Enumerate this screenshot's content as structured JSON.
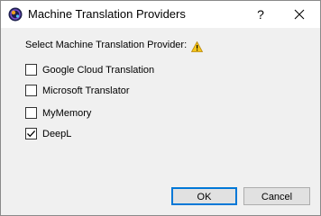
{
  "window": {
    "title": "Machine Translation Providers",
    "help_label": "?"
  },
  "dialog": {
    "prompt": "Select Machine Translation Provider:",
    "warning_icon": "warning-icon",
    "providers": [
      {
        "label": "Google Cloud Translation",
        "checked": false
      },
      {
        "label": "Microsoft Translator",
        "checked": false
      },
      {
        "label": "MyMemory",
        "checked": false
      },
      {
        "label": "DeepL",
        "checked": true
      }
    ]
  },
  "buttons": {
    "ok": "OK",
    "cancel": "Cancel"
  },
  "colors": {
    "accent": "#0078d7",
    "warning": "#f5c518"
  }
}
